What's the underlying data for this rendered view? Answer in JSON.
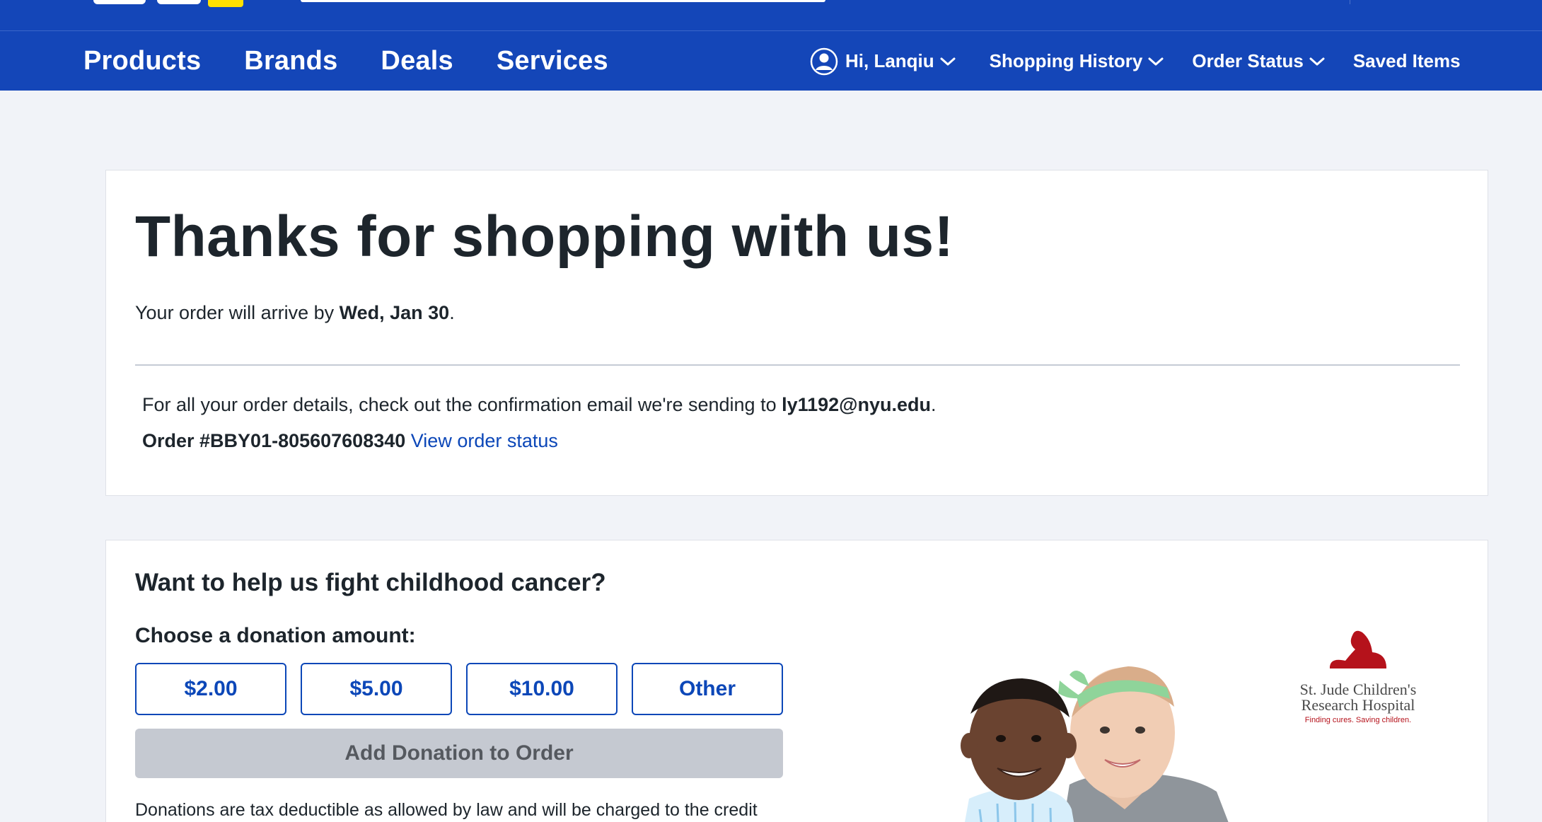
{
  "nav": {
    "left": [
      "Products",
      "Brands",
      "Deals",
      "Services"
    ],
    "greeting": "Hi, Lanqiu",
    "shopping_history": "Shopping History",
    "order_status": "Order Status",
    "saved_items": "Saved Items"
  },
  "confirmation": {
    "title": "Thanks for shopping with us!",
    "arrive_prefix": "Your order will arrive by ",
    "arrive_date": "Wed, Jan 30",
    "arrive_suffix": ".",
    "details_prefix": "For all your order details, check out the confirmation email we're sending to ",
    "email": "ly1192@nyu.edu",
    "details_suffix": ".",
    "order_number": "Order #BBY01-805607608340",
    "view_status_link": "View order status"
  },
  "donation": {
    "title": "Want to help us fight childhood cancer?",
    "choose_label": "Choose a donation amount:",
    "amounts": [
      "$2.00",
      "$5.00",
      "$10.00",
      "Other"
    ],
    "add_button": "Add Donation to Order",
    "legal_text": "Donations are tax deductible as allowed by law and will be charged to the credit",
    "partner": {
      "name_line1": "St. Jude Children's",
      "name_line2": "Research Hospital",
      "tagline": "Finding cures. Saving children."
    }
  },
  "colors": {
    "brand_blue": "#1446b8",
    "brand_yellow": "#ffe000",
    "link_blue": "#0c47b8",
    "stjude_red": "#b5121b"
  }
}
